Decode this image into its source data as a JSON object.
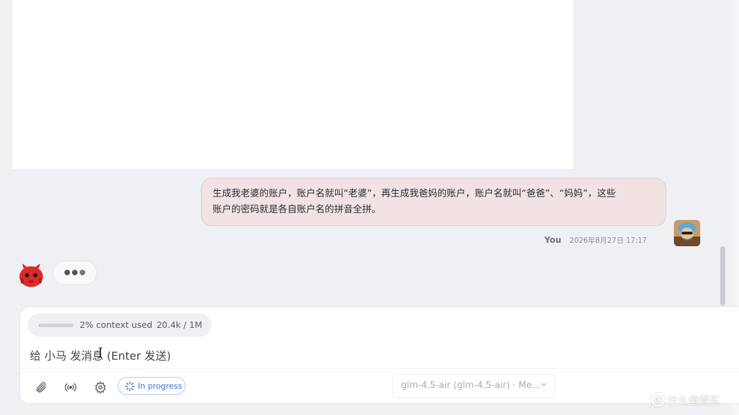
{
  "colors": {
    "background": "#eef0f4",
    "user_bubble_bg": "#f1e3e3",
    "accent_blue": "#3b6fd6",
    "bot_avatar_red": "#d92b2b"
  },
  "conversation": {
    "user_message": {
      "line1": "生成我老婆的账户，账户名就叫“老婆”，再生成我爸妈的账户，账户名就叫“爸爸”、“妈妈”，这些",
      "line2": "账户的密码就是各自账户名的拼音全拼。",
      "sender": "You",
      "timestamp": "2026年8月27日 17:17",
      "avatar_icon": "user-avatar-icon"
    },
    "assistant": {
      "avatar_icon": "red-robot-avatar-icon",
      "typing_indicator": "typing-dots-icon"
    }
  },
  "composer": {
    "context": {
      "used_fraction": 0.02,
      "percent_label": "2% context used",
      "tokens_label": "20.4k / 1M"
    },
    "input_value": "给 小马 发消息 (Enter 发送)",
    "tools": {
      "attach_icon": "paperclip-icon",
      "broadcast_icon": "broadcast-icon",
      "settings_icon": "gear-icon",
      "status_icon": "spinner-icon",
      "status_label": "In progress"
    },
    "model_selector": {
      "value": "glm-4.5-air (glm-4.5-air) · Me...",
      "chevron_icon": "chevron-down-icon"
    }
  },
  "watermark": {
    "logo_icon": "zhi-logo-icon",
    "logo_char": "值",
    "text": "什么值得买"
  }
}
